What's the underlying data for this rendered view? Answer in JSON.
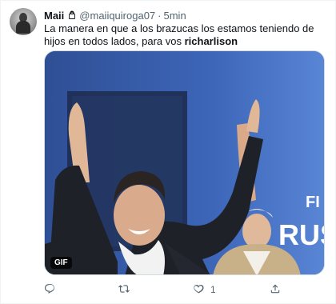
{
  "tweet": {
    "author_name": "Maii",
    "handle": "@maiiquiroga07",
    "separator": "·",
    "time": "5min",
    "text_part1": "La manera en que a los brazucas los estamos teniendo de hijos en todos lados, para vos ",
    "mention": "richarlison",
    "media_badge": "GIF",
    "media_overlay_text": "FI\nRUS",
    "more_label": "···"
  },
  "actions": {
    "reply_icon": "reply-icon",
    "retweet_icon": "retweet-icon",
    "like_icon": "heart-icon",
    "like_count": "1",
    "share_icon": "share-icon"
  },
  "colors": {
    "text_primary": "#0f1419",
    "text_secondary": "#536471",
    "border": "#cfd9de",
    "media_bg": "#3b5fa8"
  }
}
